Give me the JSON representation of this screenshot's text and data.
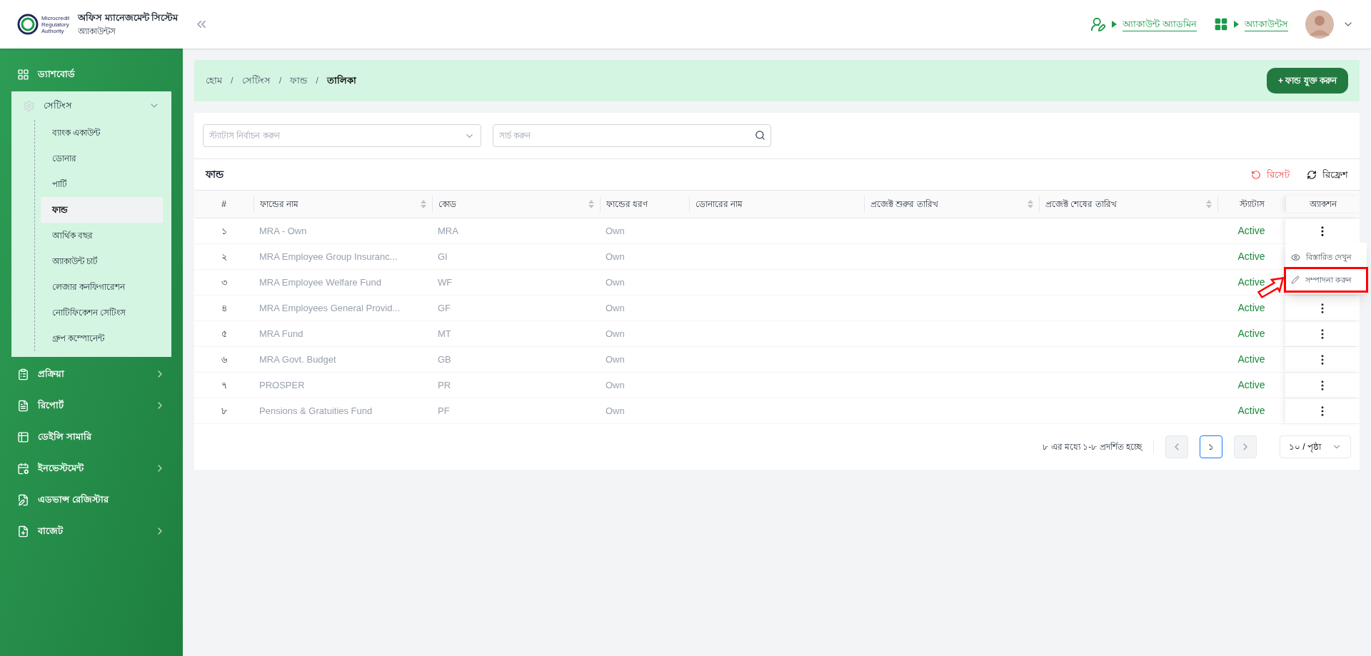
{
  "app": {
    "title": "অফিস ম্যানেজমেন্ট সিস্টেম",
    "subtitle": "অ্যাকাউন্টস",
    "logo_text": [
      "Microcredit",
      "Regulatory",
      "Authority"
    ]
  },
  "header": {
    "links": [
      {
        "kind": "role",
        "label": "অ্যাকাউন্ট অ্যাডমিন"
      },
      {
        "kind": "module",
        "label": "অ্যাকাউন্টস"
      }
    ]
  },
  "sidebar": {
    "items": [
      {
        "label": "ড্যাশবোর্ড",
        "kind": "link"
      },
      {
        "label": "সেটিংস",
        "kind": "group",
        "expanded": true,
        "children": [
          {
            "label": "ব্যাংক একাউন্ট",
            "selected": false
          },
          {
            "label": "ডোনার",
            "selected": false
          },
          {
            "label": "পার্টি",
            "selected": false
          },
          {
            "label": "ফান্ড",
            "selected": true
          },
          {
            "label": "আর্থিক বছর",
            "selected": false
          },
          {
            "label": "অ্যাকাউন্ট চার্ট",
            "selected": false
          },
          {
            "label": "লেজার কনফিগারেশন",
            "selected": false
          },
          {
            "label": "নোটিফিকেশন সেটিংস",
            "selected": false
          },
          {
            "label": "গ্রুপ কম্পোনেন্ট",
            "selected": false
          }
        ]
      },
      {
        "label": "প্রক্রিয়া",
        "kind": "group",
        "expanded": false
      },
      {
        "label": "রিপোর্ট",
        "kind": "group",
        "expanded": false
      },
      {
        "label": "ডেইলি সামারি",
        "kind": "link"
      },
      {
        "label": "ইনভেস্টমেন্ট",
        "kind": "group",
        "expanded": false
      },
      {
        "label": "এডভান্স রেজিস্টার",
        "kind": "link"
      },
      {
        "label": "বাজেট",
        "kind": "group",
        "expanded": false
      }
    ]
  },
  "breadcrumb": [
    "হোম",
    "সেটিংস",
    "ফান্ড",
    "তালিকা"
  ],
  "breadcrumb_separator": "/",
  "add_button": "+ ফান্ড যুক্ত করুন",
  "filters": {
    "status": {
      "placeholder": "স্ট্যাটাস নির্বাচন করুন"
    },
    "search": {
      "placeholder": "সার্চ করুন"
    }
  },
  "table": {
    "title": "ফান্ড",
    "reset": "রিসেট",
    "refresh": "রিফ্রেশ",
    "columns": [
      {
        "label": "#",
        "sortable": false
      },
      {
        "label": "ফান্ডের নাম",
        "sortable": true
      },
      {
        "label": "কোড",
        "sortable": true
      },
      {
        "label": "ফান্ডের ধরণ",
        "sortable": false
      },
      {
        "label": "ডোনারের নাম",
        "sortable": false
      },
      {
        "label": "প্রজেক্ট শুরুর তারিখ",
        "sortable": true
      },
      {
        "label": "প্রজেক্ট শেষের তারিখ",
        "sortable": true
      },
      {
        "label": "স্ট্যাটাস",
        "sortable": false
      },
      {
        "label": "অ্যাকশন",
        "sortable": false
      }
    ],
    "rows": [
      {
        "num": "১",
        "name": "MRA - Own",
        "code": "MRA",
        "type": "Own",
        "status": "Active",
        "menu_open": true
      },
      {
        "num": "২",
        "name": "MRA Employee Group Insuranc...",
        "code": "GI",
        "type": "Own",
        "status": "Active",
        "menu_open": false
      },
      {
        "num": "৩",
        "name": "MRA Employee Welfare Fund",
        "code": "WF",
        "type": "Own",
        "status": "Active",
        "menu_open": false
      },
      {
        "num": "৪",
        "name": "MRA Employees General Provid...",
        "code": "GF",
        "type": "Own",
        "status": "Active",
        "menu_open": false
      },
      {
        "num": "৫",
        "name": "MRA Fund",
        "code": "MT",
        "type": "Own",
        "status": "Active",
        "menu_open": false
      },
      {
        "num": "৬",
        "name": "MRA Govt. Budget",
        "code": "GB",
        "type": "Own",
        "status": "Active",
        "menu_open": false
      },
      {
        "num": "৭",
        "name": "PROSPER",
        "code": "PR",
        "type": "Own",
        "status": "Active",
        "menu_open": false
      },
      {
        "num": "৮",
        "name": "Pensions & Gratuities Fund",
        "code": "PF",
        "type": "Own",
        "status": "Active",
        "menu_open": false
      }
    ],
    "action_menu": [
      {
        "kind": "view",
        "label": "বিস্তারিত দেখুন",
        "highlighted": false
      },
      {
        "kind": "edit",
        "label": "সম্পাদনা করুন",
        "highlighted": true
      }
    ]
  },
  "pagination": {
    "summary": "৮ এর মধ্যে ১-৮ প্রদর্শিত হচ্ছে",
    "pages": [
      {
        "label": "১",
        "selected": true
      }
    ],
    "page_size": "১০ / পৃষ্ঠা"
  }
}
